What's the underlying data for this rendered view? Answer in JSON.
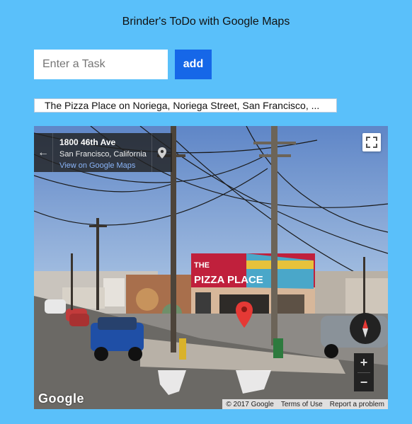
{
  "app": {
    "title": "Brinder's ToDo with Google Maps"
  },
  "task_form": {
    "placeholder": "Enter a Task",
    "add_label": "add"
  },
  "tasks": [
    {
      "text": "The Pizza Place on Noriega, Noriega Street, San Francisco, ..."
    }
  ],
  "streetview": {
    "address": "1800 46th Ave",
    "city": "San Francisco, California",
    "view_link": "View on Google Maps",
    "back_icon": "arrow-left-icon",
    "pin_icon": "map-pin-icon",
    "sign_line1": "THE",
    "sign_line2": "PIZZA PLACE",
    "logo": "Google",
    "zoom_in": "+",
    "zoom_out": "−",
    "footer": [
      "© 2017 Google",
      "Terms of Use",
      "Report a problem"
    ]
  },
  "colors": {
    "background": "#5ac0fa",
    "button": "#1667e8",
    "marker": "#e53935"
  }
}
